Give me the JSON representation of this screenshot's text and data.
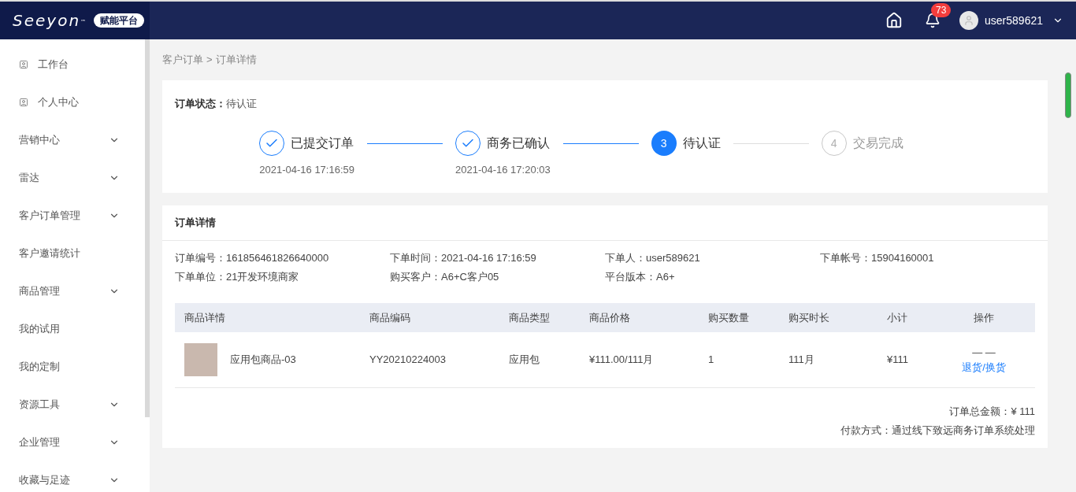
{
  "header": {
    "logo": {
      "text": "Seeyon",
      "mark": "™",
      "badge": "赋能平台"
    },
    "notifications": "73",
    "user": "user589621"
  },
  "sidebar": {
    "items": [
      {
        "label": "工作台",
        "kind": "icon"
      },
      {
        "label": "个人中心",
        "kind": "icon"
      },
      {
        "label": "营销中心",
        "kind": "group"
      },
      {
        "label": "雷达",
        "kind": "group"
      },
      {
        "label": "客户订单管理",
        "kind": "group"
      },
      {
        "label": "客户邀请统计",
        "kind": "plain"
      },
      {
        "label": "商品管理",
        "kind": "group"
      },
      {
        "label": "我的试用",
        "kind": "plain"
      },
      {
        "label": "我的定制",
        "kind": "plain"
      },
      {
        "label": "资源工具",
        "kind": "group"
      },
      {
        "label": "企业管理",
        "kind": "group"
      },
      {
        "label": "收藏与足迹",
        "kind": "group"
      }
    ]
  },
  "breadcrumb": {
    "items": [
      "客户订单",
      "订单详情"
    ],
    "separator": ">"
  },
  "status_card": {
    "label": "订单状态：",
    "value": "待认证",
    "steps": [
      {
        "label": "已提交订单",
        "time": "2021-04-16 17:16:59",
        "done": true,
        "selected": false
      },
      {
        "label": "商务已确认",
        "time": "2021-04-16 17:20:03",
        "done": true,
        "selected": false
      },
      {
        "number": "3",
        "label": "待认证",
        "done": false,
        "selected": true
      },
      {
        "number": "4",
        "label": "交易完成",
        "done": false,
        "selected": false
      }
    ]
  },
  "detail_card": {
    "title": "订单详情",
    "fields": [
      {
        "label": "订单编号：",
        "value": "161856461826640000"
      },
      {
        "label": "下单时间：",
        "value": "2021-04-16 17:16:59"
      },
      {
        "label": "下单人：",
        "value": "user589621"
      },
      {
        "label": "下单帐号：",
        "value": "15904160001"
      },
      {
        "label": "下单单位：",
        "value": "21开发环境商家"
      },
      {
        "label": "购买客户：",
        "value": "A6+C客户05"
      },
      {
        "label": "平台版本：",
        "value": "A6+"
      }
    ],
    "table": {
      "columns": [
        "商品详情",
        "商品编码",
        "商品类型",
        "商品价格",
        "购买数量",
        "购买时长",
        "小计",
        "操作"
      ],
      "rows": [
        {
          "name": "应用包商品-03",
          "code": "YY20210224003",
          "type": "应用包",
          "price": "¥111.00/111月",
          "quantity": "1",
          "duration": "111月",
          "subtotal": "¥111",
          "action_placeholder": "— —",
          "action": "退货/换货"
        }
      ]
    },
    "total": {
      "label": "订单总金额：",
      "value": "¥ 111"
    },
    "payment": {
      "label": "付款方式：",
      "value": "通过线下致远商务订单系统处理"
    }
  }
}
